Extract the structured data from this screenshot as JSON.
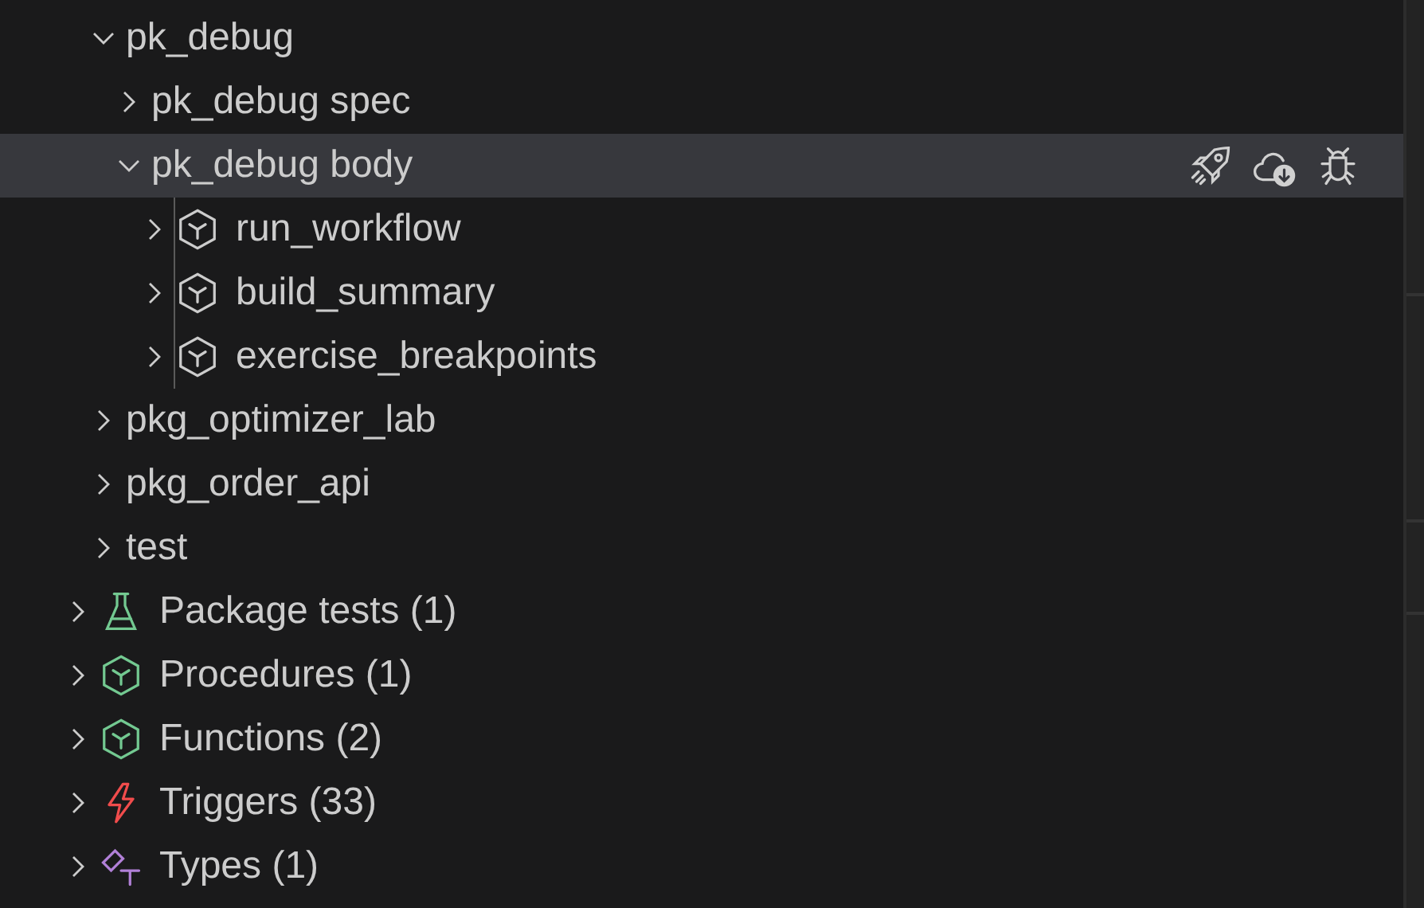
{
  "tree": {
    "continued_children": [
      {
        "label": "pk_debug",
        "expanded": true,
        "selected": false,
        "children": [
          {
            "label": "pk_debug spec",
            "expanded": false,
            "selected": false
          },
          {
            "label": "pk_debug body",
            "expanded": true,
            "selected": true,
            "actions": [
              {
                "kind": "rocket"
              },
              {
                "kind": "cloud-download"
              },
              {
                "kind": "bug"
              }
            ],
            "children": [
              {
                "label": "run_workflow",
                "expanded": false,
                "selected": false,
                "kind": "cube",
                "color": "#cccccc"
              },
              {
                "label": "build_summary",
                "expanded": false,
                "selected": false,
                "kind": "cube",
                "color": "#cccccc"
              },
              {
                "label": "exercise_breakpoints",
                "expanded": false,
                "selected": false,
                "kind": "cube",
                "color": "#cccccc"
              }
            ]
          }
        ]
      },
      {
        "label": "pkg_optimizer_lab",
        "expanded": false,
        "selected": false
      },
      {
        "label": "pkg_order_api",
        "expanded": false,
        "selected": false
      },
      {
        "label": "test",
        "expanded": false,
        "selected": false
      }
    ],
    "items": [
      {
        "label": "Package tests (1)",
        "expanded": false,
        "selected": false,
        "kind": "flask",
        "color": "#73c991"
      },
      {
        "label": "Procedures (1)",
        "expanded": false,
        "selected": false,
        "kind": "cube",
        "color": "#73c991"
      },
      {
        "label": "Functions (2)",
        "expanded": false,
        "selected": false,
        "kind": "cube",
        "color": "#73c991"
      },
      {
        "label": "Triggers (33)",
        "expanded": false,
        "selected": false,
        "kind": "bolt",
        "color": "#f14c4c"
      },
      {
        "label": "Types (1)",
        "expanded": false,
        "selected": false,
        "kind": "type",
        "color": "#b180d7"
      }
    ]
  }
}
